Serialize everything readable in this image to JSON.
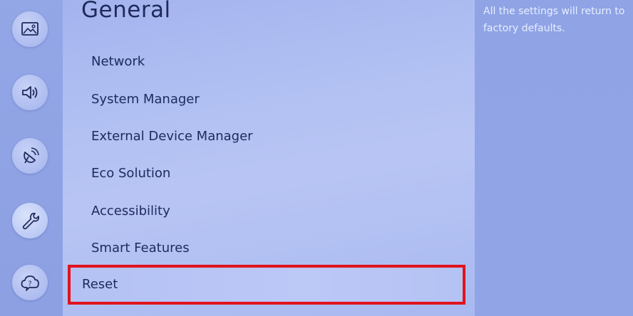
{
  "sidebar": {
    "icons": [
      {
        "name": "picture-icon"
      },
      {
        "name": "sound-icon"
      },
      {
        "name": "broadcasting-icon"
      },
      {
        "name": "general-icon"
      },
      {
        "name": "support-icon"
      }
    ],
    "selected_icon": "general-icon"
  },
  "panel": {
    "title": "General",
    "items": [
      {
        "label": "Network"
      },
      {
        "label": "System Manager"
      },
      {
        "label": "External Device Manager"
      },
      {
        "label": "Eco Solution"
      },
      {
        "label": "Accessibility"
      },
      {
        "label": "Smart Features"
      },
      {
        "label": "Reset"
      }
    ],
    "highlighted_item": "Reset",
    "highlight_color": "#e0141c"
  },
  "help": {
    "text": "All the settings will return to factory defaults."
  }
}
